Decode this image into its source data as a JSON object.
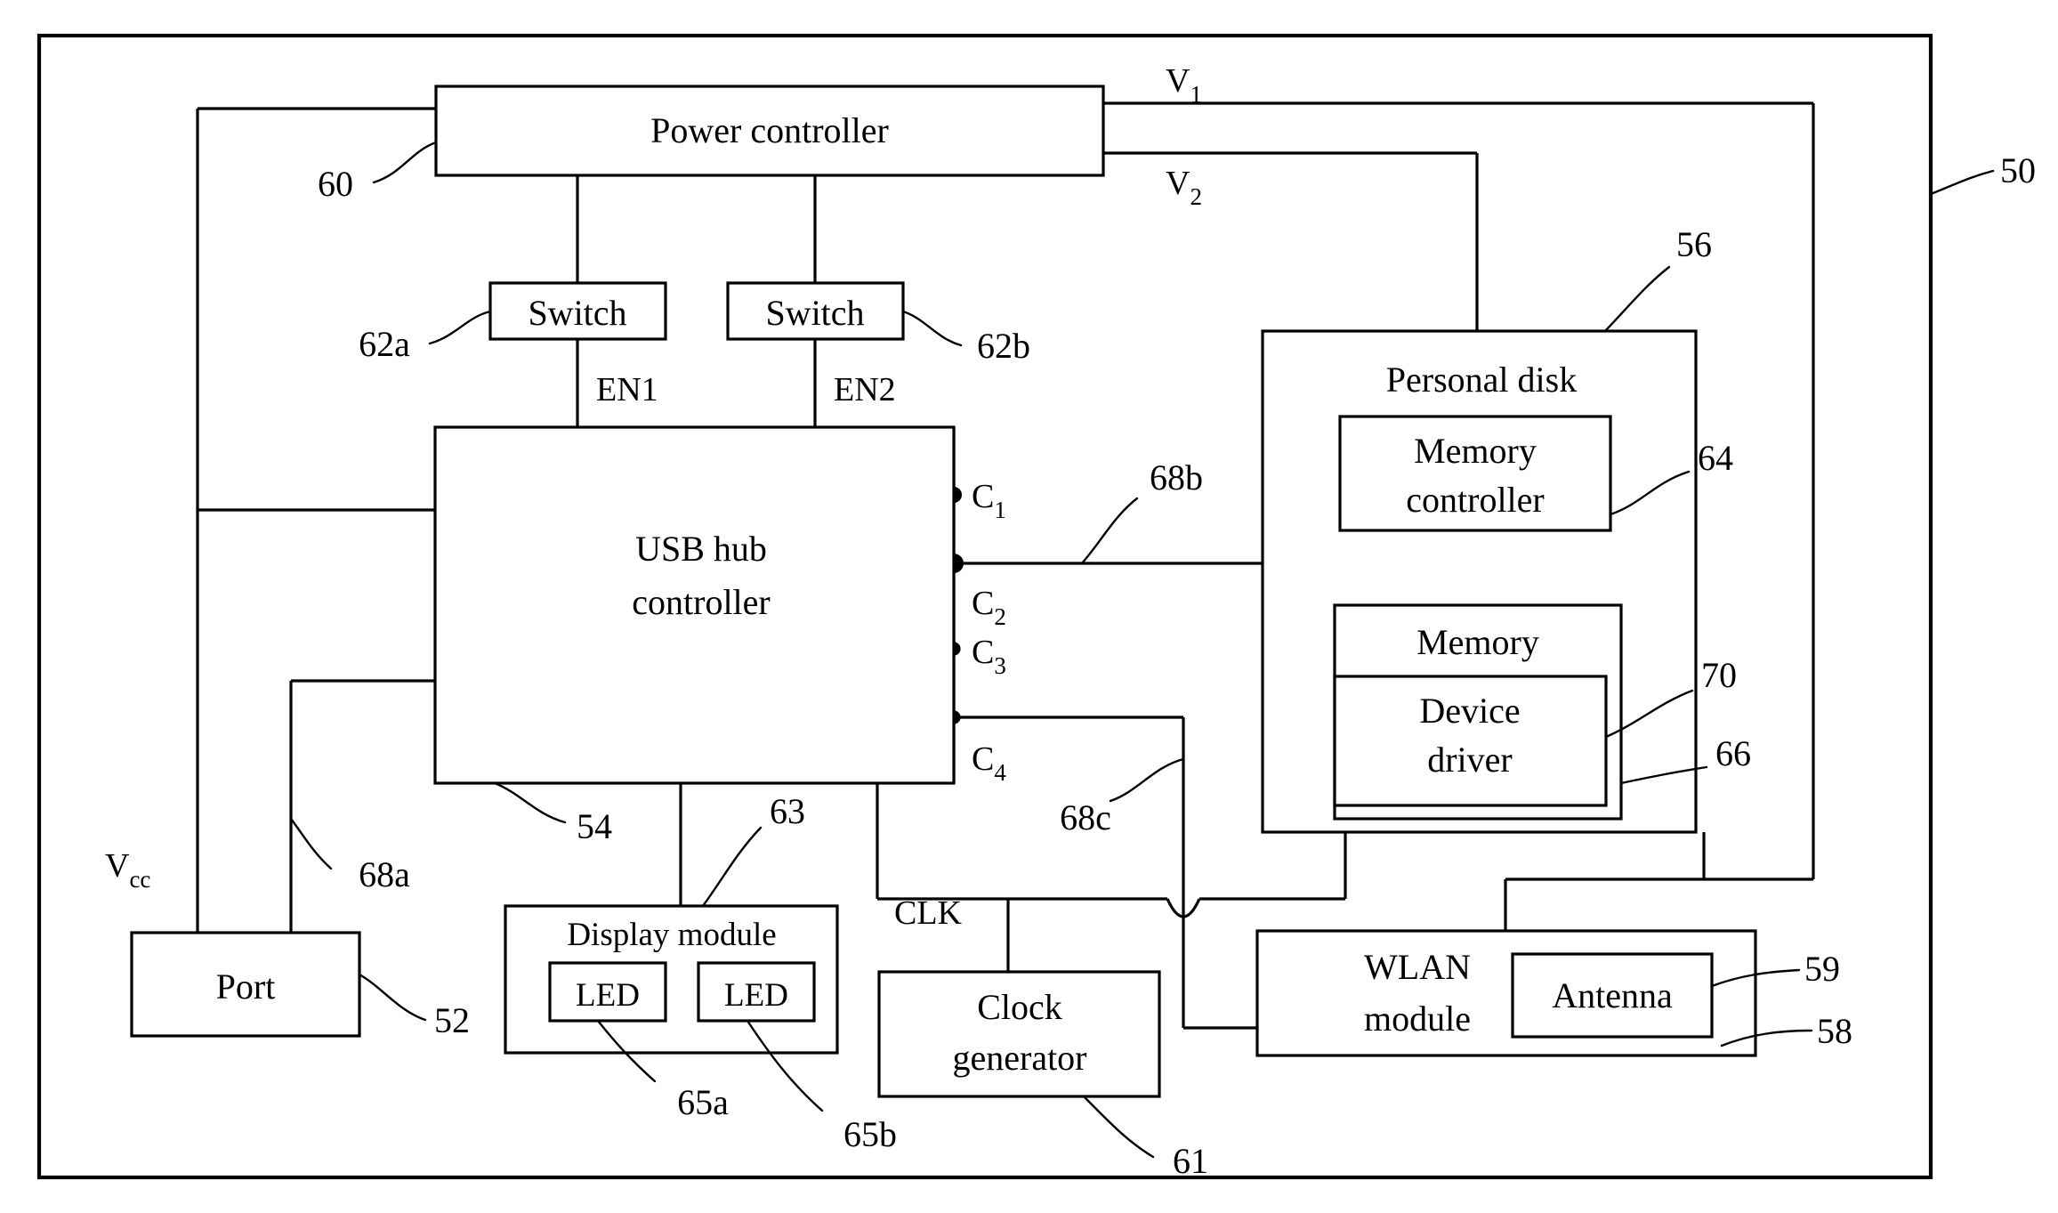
{
  "figure": {
    "type": "patent-block-diagram",
    "overall_ref": "50",
    "blocks": {
      "power_controller": {
        "label": "Power controller",
        "ref": "60"
      },
      "switch_a": {
        "label": "Switch",
        "ref": "62a"
      },
      "switch_b": {
        "label": "Switch",
        "ref": "62b"
      },
      "usb_hub": {
        "label_line1": "USB hub",
        "label_line2": "controller",
        "ref": "54"
      },
      "personal_disk": {
        "label": "Personal disk",
        "ref": "56"
      },
      "memory_controller": {
        "label_line1": "Memory",
        "label_line2": "controller",
        "ref": "64"
      },
      "memory": {
        "label": "Memory",
        "ref": "66"
      },
      "device_driver": {
        "label_line1": "Device",
        "label_line2": "driver",
        "ref": "70"
      },
      "port": {
        "label": "Port",
        "ref": "52"
      },
      "display_module": {
        "label": "Display module",
        "ref": "63"
      },
      "led_a": {
        "label": "LED",
        "ref": "65a"
      },
      "led_b": {
        "label": "LED",
        "ref": "65b"
      },
      "clock_generator": {
        "label_line1": "Clock",
        "label_line2": "generator",
        "ref": "61"
      },
      "wlan_module": {
        "label_line1": "WLAN",
        "label_line2": "module",
        "ref": "58"
      },
      "antenna": {
        "label": "Antenna",
        "ref": "59"
      }
    },
    "signals": {
      "v1": {
        "base": "V",
        "sub": "1"
      },
      "v2": {
        "base": "V",
        "sub": "2"
      },
      "vcc": {
        "base": "V",
        "sub": "cc"
      },
      "en1": "EN1",
      "en2": "EN2",
      "clk": "CLK"
    },
    "connection_points": [
      {
        "base": "C",
        "sub": "1"
      },
      {
        "base": "C",
        "sub": "2"
      },
      {
        "base": "C",
        "sub": "3"
      },
      {
        "base": "C",
        "sub": "4"
      }
    ],
    "bus_refs": {
      "bus_a": "68a",
      "bus_b": "68b",
      "bus_c": "68c"
    },
    "colors": {
      "line": "#000000",
      "background": "#ffffff"
    }
  }
}
